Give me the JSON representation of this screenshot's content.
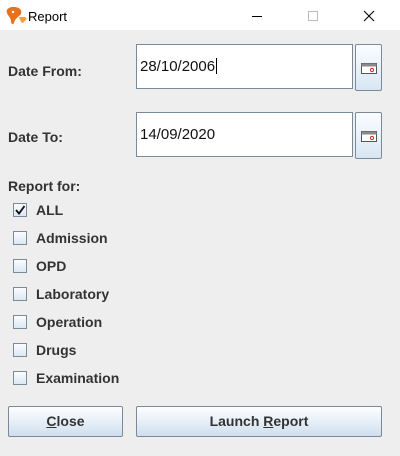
{
  "window": {
    "title": "Report",
    "controls": {
      "minimize": "minimize-icon",
      "maximize": "maximize-icon",
      "close": "close-icon"
    }
  },
  "form": {
    "date_from_label": "Date From:",
    "date_from_value": "28/10/2006",
    "date_to_label": "Date To:",
    "date_to_value": "14/09/2020",
    "report_for_label": "Report for:",
    "options": [
      {
        "label": "ALL",
        "checked": true
      },
      {
        "label": "Admission",
        "checked": false
      },
      {
        "label": "OPD",
        "checked": false
      },
      {
        "label": "Laboratory",
        "checked": false
      },
      {
        "label": "Operation",
        "checked": false
      },
      {
        "label": "Drugs",
        "checked": false
      },
      {
        "label": "Examination",
        "checked": false
      }
    ]
  },
  "buttons": {
    "close_first": "C",
    "close_rest": "lose",
    "launch_pre": "Launch ",
    "launch_mnemonic": "R",
    "launch_post": "eport"
  },
  "colors": {
    "panel_bg": "#eeeeee",
    "border": "#7a8a99",
    "label_text": "#333333",
    "icon_orange": "#e8711e"
  }
}
